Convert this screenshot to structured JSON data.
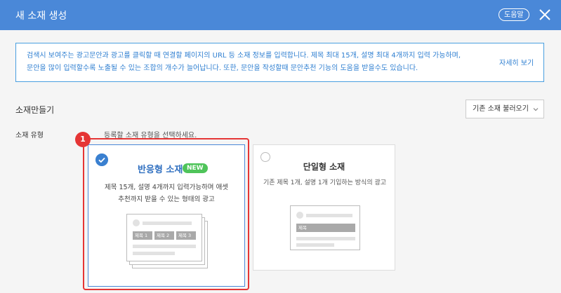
{
  "header": {
    "title": "새 소재 생성",
    "help_label": "도움말"
  },
  "info": {
    "line1": "검색시 보여주는 광고문안과 광고를 클릭할 때 연결할 페이지의 URL 등 소재 정보를 입력합니다. 제목 최대 15개, 설명 최대 4개까지 입력 가능하며,",
    "line2": "문안을 많이 입력할수록 노출될 수 있는 조합의 개수가 늘어납니다. 또한, 문안을 작성할때 문안추천 기능의 도움을 받을수도 있습니다.",
    "more_label": "자세히 보기"
  },
  "section": {
    "title": "소재만들기",
    "load_label": "기존 소재 불러오기"
  },
  "type": {
    "label": "소재 유형",
    "hint": "등록할 소재 유형을 선택하세요.",
    "callout_number": "1"
  },
  "cards": {
    "responsive": {
      "title": "반응형 소재",
      "badge": "NEW",
      "desc_line1": "제목 15개, 설명 4개까지 입력가능하며 애셋",
      "desc_line2": "추천까지 받을 수 있는 형태의 광고",
      "tag1": "제목 1",
      "tag2": "제목 2",
      "tag3": "제목 3",
      "selected": true
    },
    "single": {
      "title": "단일형 소재",
      "desc": "기존 제목 1개, 설명 1개 기입하는 방식의 광고",
      "tag": "제목",
      "selected": false
    }
  },
  "colors": {
    "header_bg": "#4a88d8",
    "accent": "#2f7fd1",
    "callout": "#e53535",
    "new_badge": "#4fc45a"
  },
  "icons": {
    "close": "close-icon",
    "check": "check-circle-icon",
    "radio": "radio-empty-icon",
    "chevron": "chevron-down-icon"
  }
}
